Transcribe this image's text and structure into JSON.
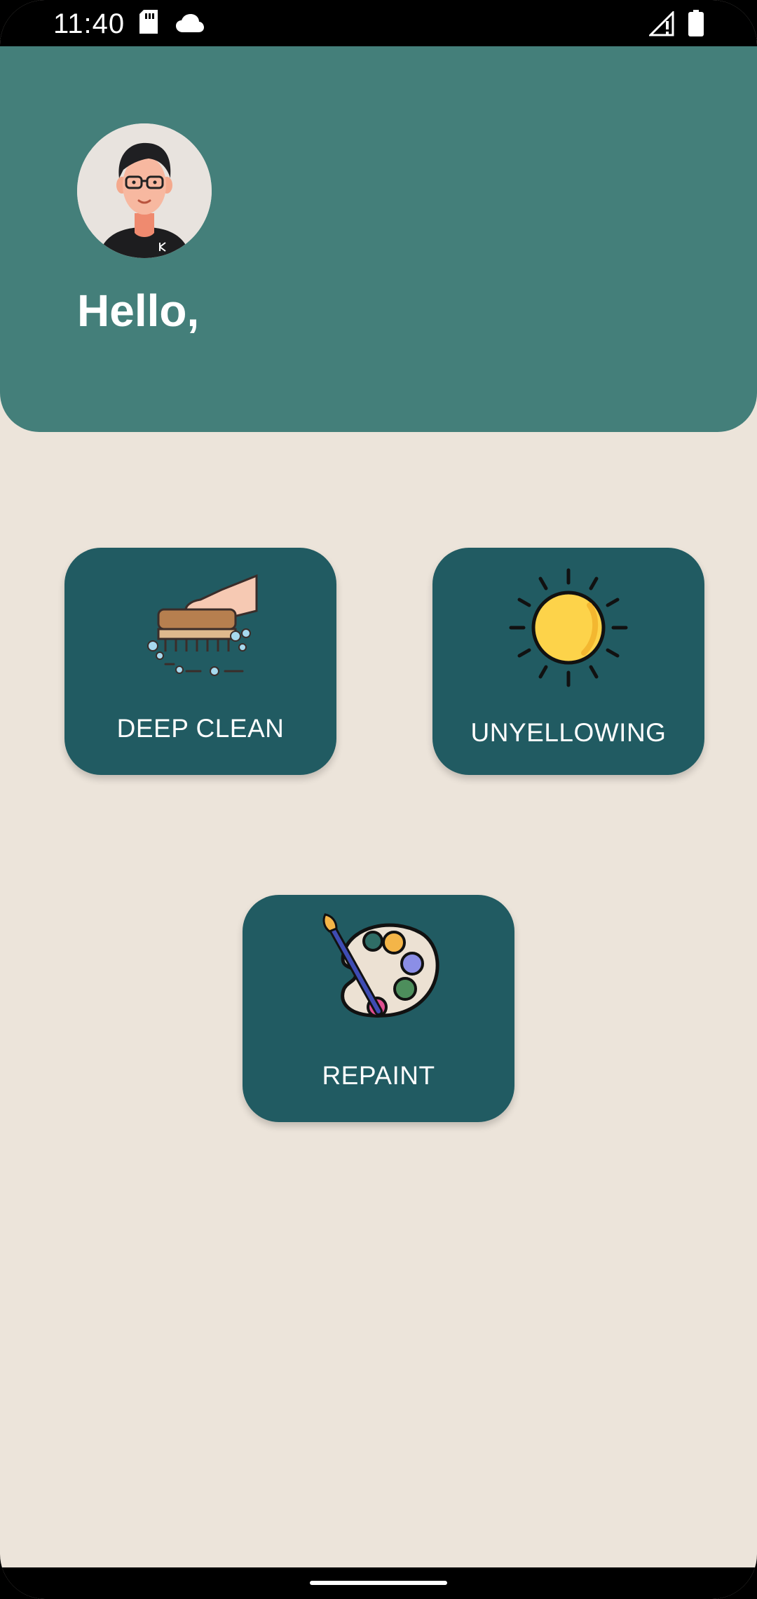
{
  "status_bar": {
    "time": "11:40",
    "left_icons": [
      "sd-card-icon",
      "cloud-icon"
    ],
    "right_icons": [
      "signal-icon",
      "battery-icon"
    ]
  },
  "header": {
    "greeting": "Hello,",
    "avatar_icon": "user-avatar-icon",
    "background_color": "#447f7a"
  },
  "services": [
    {
      "label": "DEEP CLEAN",
      "icon": "brush-icon"
    },
    {
      "label": "UNYELLOWING",
      "icon": "sun-icon"
    },
    {
      "label": "REPAINT",
      "icon": "palette-icon"
    }
  ],
  "colors": {
    "page_background": "#ece4da",
    "card_background": "#215b62",
    "text_on_dark": "#ffffff"
  }
}
